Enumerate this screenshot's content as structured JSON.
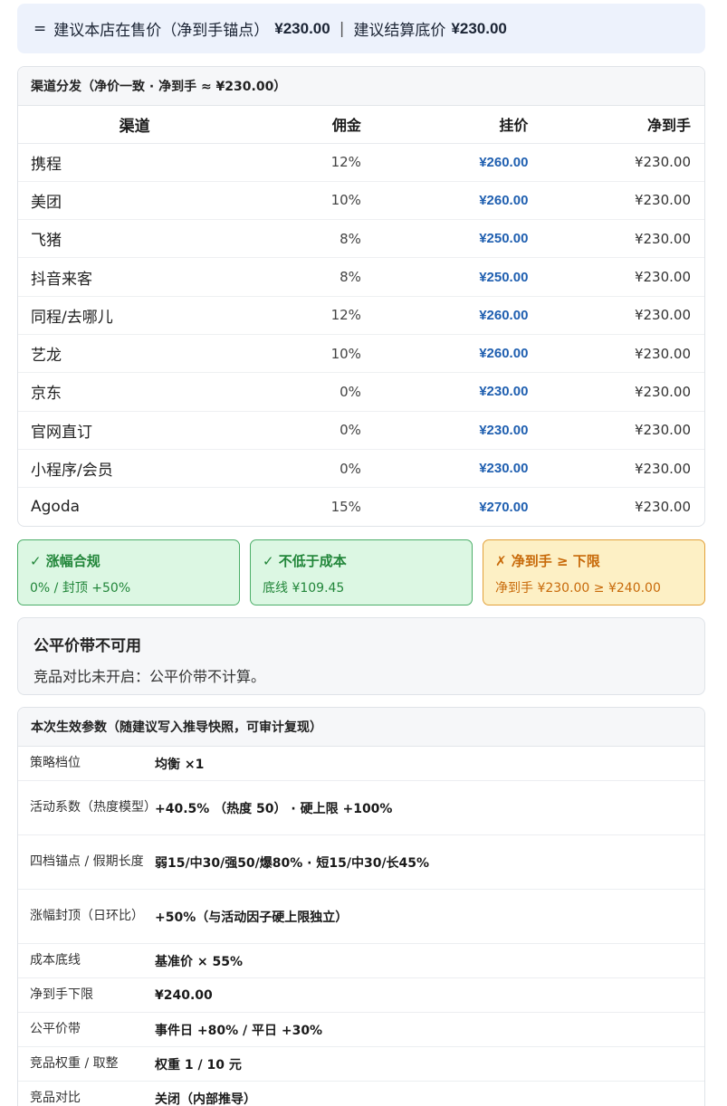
{
  "summary": {
    "eq": "=",
    "label1": "建议本店在售价（净到手锚点）",
    "value1": "¥230.00",
    "sep": "|",
    "label2": "建议结算底价",
    "value2": "¥230.00"
  },
  "channels": {
    "title": "渠道分发（净价一致 · 净到手 ≈ ¥230.00）",
    "headers": [
      "渠道",
      "佣金",
      "挂价",
      "净到手"
    ],
    "rows": [
      {
        "name": "携程",
        "commission": "12%",
        "list": "¥260.00",
        "net": "¥230.00"
      },
      {
        "name": "美团",
        "commission": "10%",
        "list": "¥260.00",
        "net": "¥230.00"
      },
      {
        "name": "飞猪",
        "commission": "8%",
        "list": "¥250.00",
        "net": "¥230.00"
      },
      {
        "name": "抖音来客",
        "commission": "8%",
        "list": "¥250.00",
        "net": "¥230.00"
      },
      {
        "name": "同程/去哪儿",
        "commission": "12%",
        "list": "¥260.00",
        "net": "¥230.00"
      },
      {
        "name": "艺龙",
        "commission": "10%",
        "list": "¥260.00",
        "net": "¥230.00"
      },
      {
        "name": "京东",
        "commission": "0%",
        "list": "¥230.00",
        "net": "¥230.00"
      },
      {
        "name": "官网直订",
        "commission": "0%",
        "list": "¥230.00",
        "net": "¥230.00"
      },
      {
        "name": "小程序/会员",
        "commission": "0%",
        "list": "¥230.00",
        "net": "¥230.00"
      },
      {
        "name": "Agoda",
        "commission": "15%",
        "list": "¥270.00",
        "net": "¥230.00"
      }
    ]
  },
  "checks": [
    {
      "title": "✓ 涨幅合规",
      "detail": "0% / 封顶 +50%",
      "status": "ok"
    },
    {
      "title": "✓ 不低于成本",
      "detail": "底线 ¥109.45",
      "status": "ok"
    },
    {
      "title": "✗ 净到手 ≥ 下限",
      "detail": "净到手 ¥230.00 ≥ ¥240.00",
      "status": "bad"
    }
  ],
  "fair_band": {
    "title": "公平价带不可用",
    "detail": "竞品对比未开启：公平价带不计算。"
  },
  "params": {
    "title": "本次生效参数（随建议写入推导快照，可审计复现）",
    "rows": [
      {
        "key": "策略档位",
        "value": "均衡 ×1"
      },
      {
        "key": "活动系数（热度模型）",
        "value": "+40.5% （热度 50） · 硬上限 +100%"
      },
      {
        "key": "四档锚点 / 假期长度",
        "value": "弱15/中30/强50/爆80% · 短15/中30/长45%"
      },
      {
        "key": "涨幅封顶（日环比）",
        "value": "+50%（与活动因子硬上限独立）"
      },
      {
        "key": "成本底线",
        "value": "基准价 × 55%"
      },
      {
        "key": "净到手下限",
        "value": "¥240.00"
      },
      {
        "key": "公平价带",
        "value": "事件日 +80% / 平日 +30%"
      },
      {
        "key": "竞品权重 / 取整",
        "value": "权重 1 / 10 元"
      },
      {
        "key": "竞品对比",
        "value": "关闭（内部推导）"
      }
    ]
  }
}
